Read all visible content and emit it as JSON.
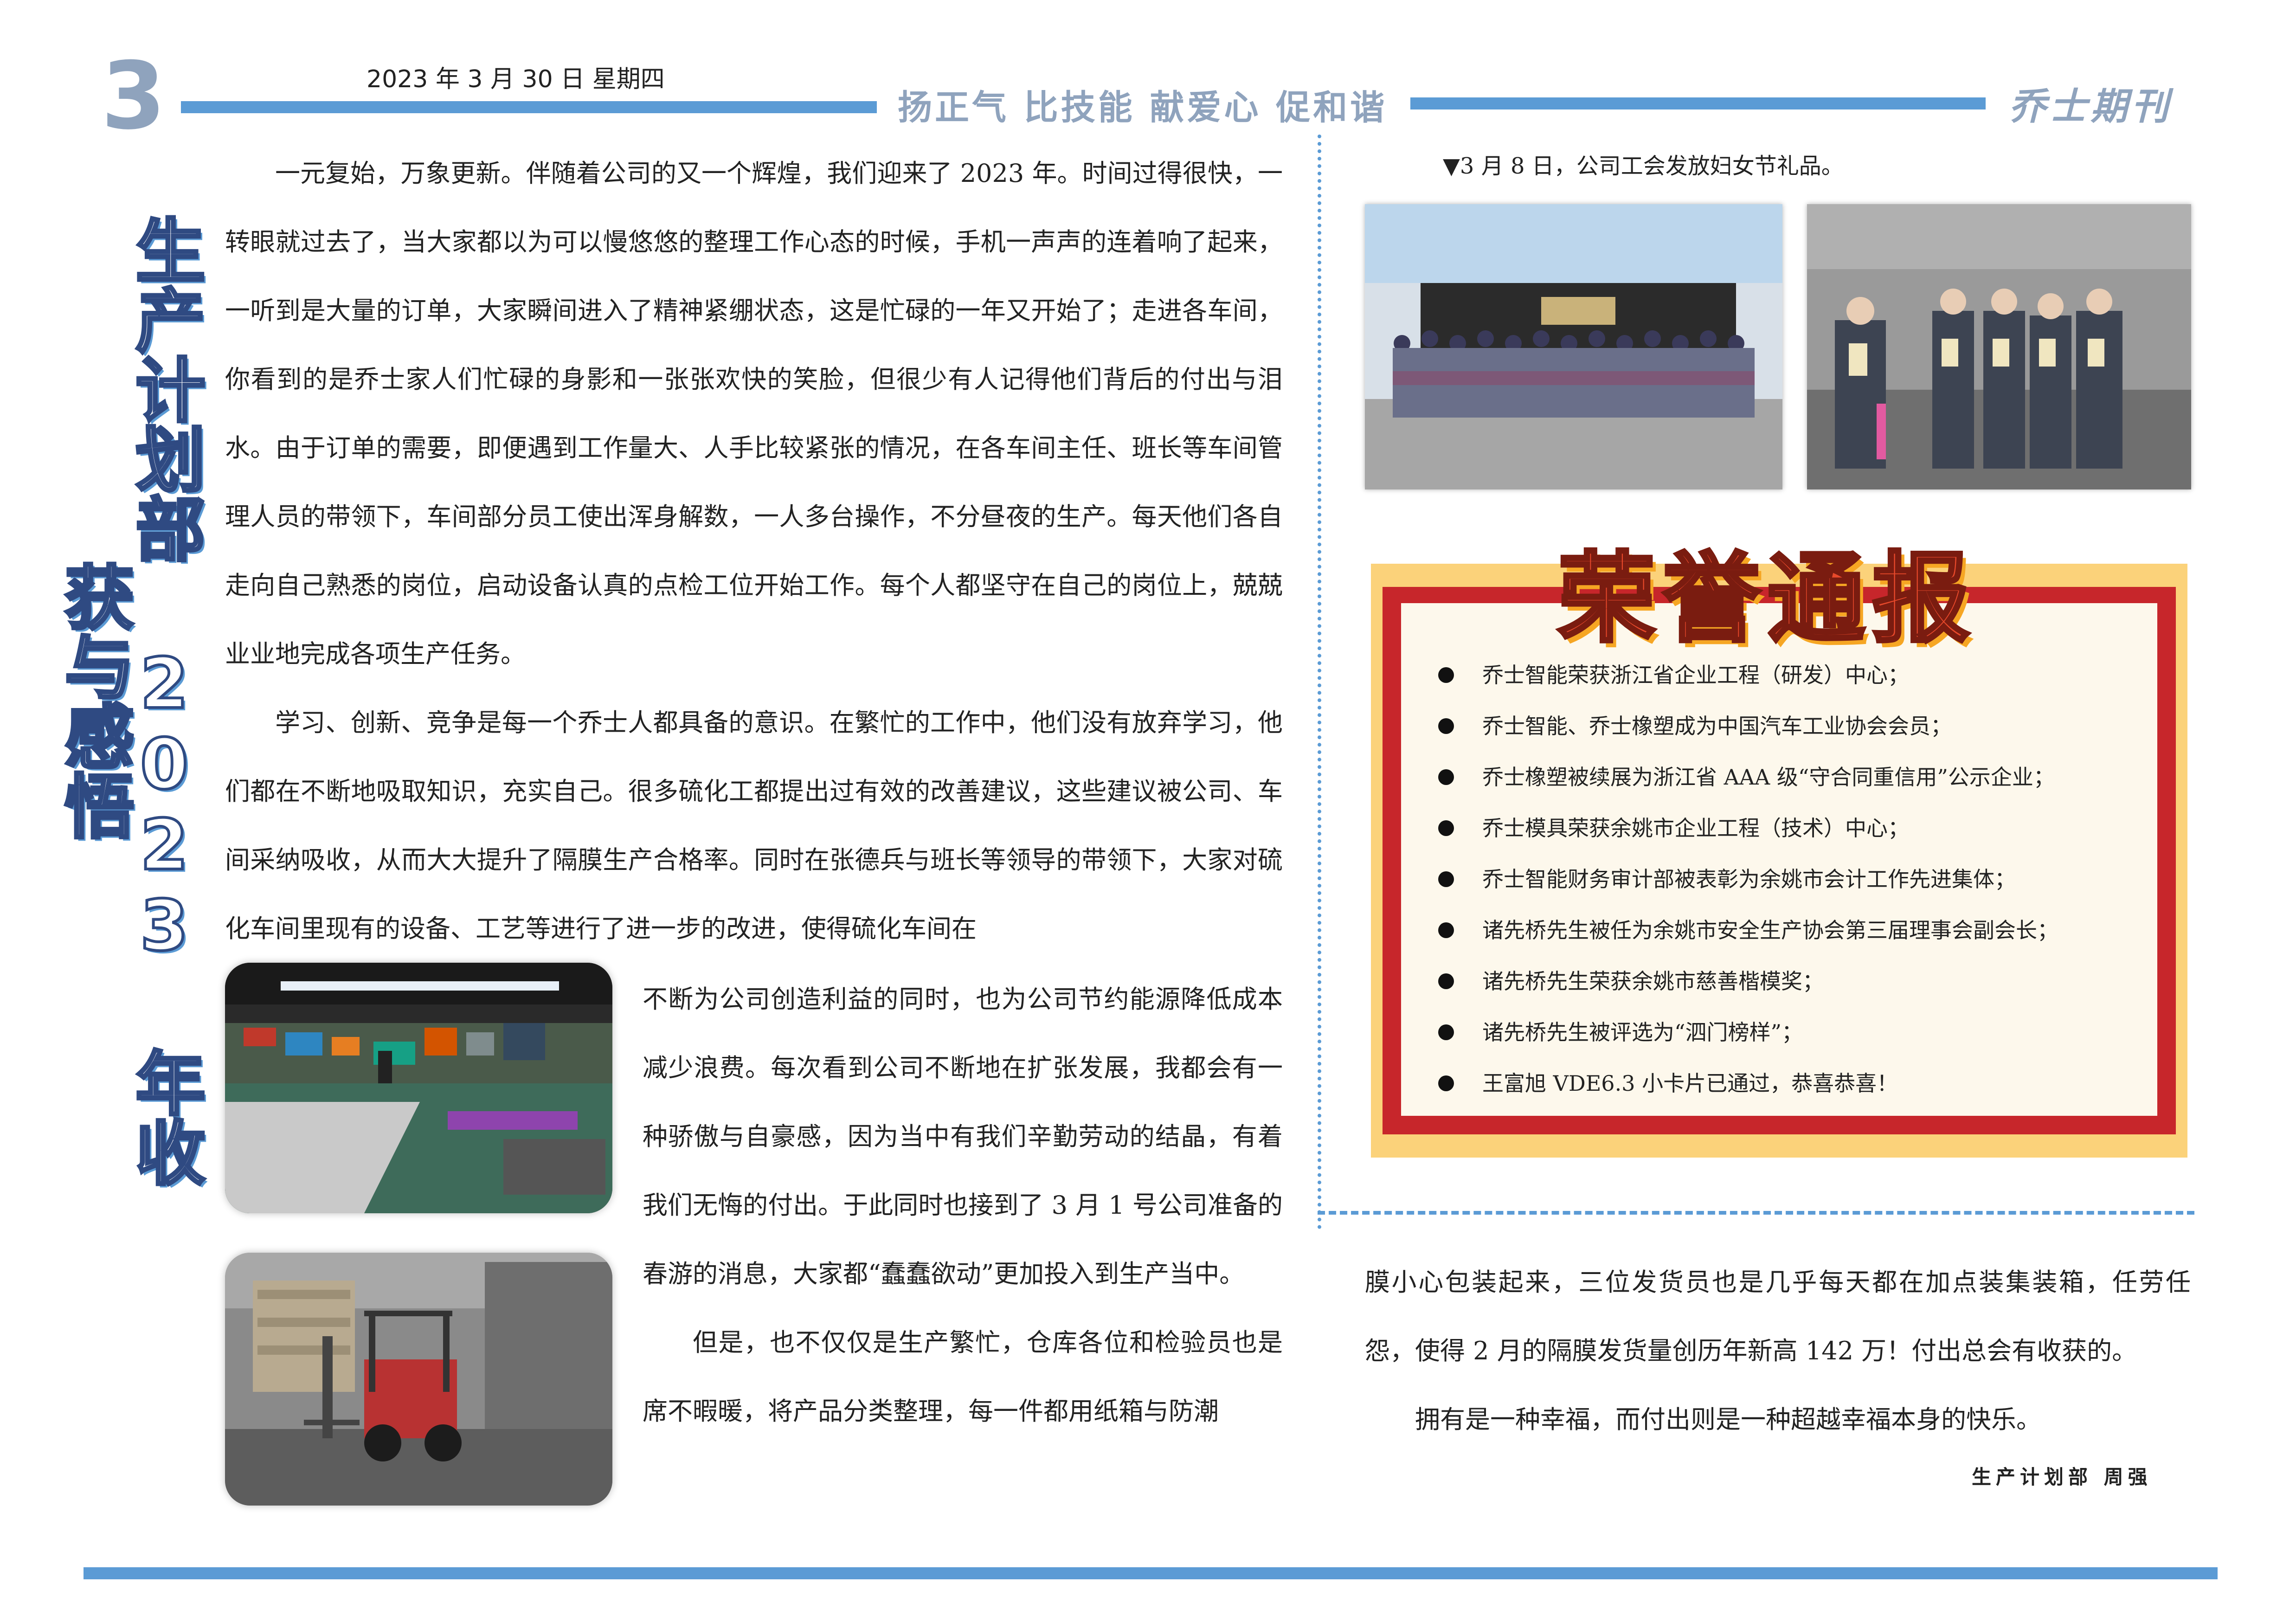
{
  "header": {
    "page_number": "3",
    "date": "2023 年 3 月 30 日    星期四",
    "slogan": "扬正气  比技能  献爱心  促和谐",
    "brand": "乔士期刊"
  },
  "article": {
    "title": "生产计划部 2023 年收获与感悟",
    "paragraph_1": "一元复始，万象更新。伴随着公司的又一个辉煌，我们迎来了 2023 年。时间过得很快，一转眼就过去了，当大家都以为可以慢悠悠的整理工作心态的时候，手机一声声的连着响了起来，一听到是大量的订单，大家瞬间进入了精神紧绷状态，这是忙碌的一年又开始了；走进各车间，你看到的是乔士家人们忙碌的身影和一张张欢快的笑脸，但很少有人记得他们背后的付出与泪水。由于订单的需要，即便遇到工作量大、人手比较紧张的情况，在各车间主任、班长等车间管理人员的带领下，车间部分员工使出浑身解数，一人多台操作，不分昼夜的生产。每天他们各自走向自己熟悉的岗位，启动设备认真的点检工位开始工作。每个人都坚守在自己的岗位上，兢兢业业地完成各项生产任务。",
    "paragraph_2": "学习、创新、竞争是每一个乔士人都具备的意识。在繁忙的工作中，他们没有放弃学习，他们都在不断地吸取知识，充实自己。很多硫化工都提出过有效的改善建议，这些建议被公司、车间采纳吸收，从而大大提升了隔膜生产合格率。同时在张德兵与班长等领导的带领下，大家对硫化车间里现有的设备、工艺等进行了进一步的改进，使得硫化车间在",
    "paragraph_2_cont": "不断为公司创造利益的同时，也为公司节约能源降低成本减少浪费。每次看到公司不断地在扩张发展，我都会有一种骄傲与自豪感，因为当中有我们辛勤劳动的结晶，有着我们无悔的付出。于此同时也接到了 3 月 1 号公司准备的春游的消息，大家都“蠢蠢欲动”更加投入到生产当中。",
    "paragraph_3": "但是，也不仅仅是生产繁忙，仓库各位和检验员也是席不暇暖，将产品分类整理，每一件都用纸箱与防潮",
    "paragraph_3_cont": "膜小心包装起来，三位发货员也是几乎每天都在加点装集装箱，任劳任怨，使得 2 月的隔膜发货量创历年新高 142 万！付出总会有收获的。",
    "paragraph_4": "拥有是一种幸福，而付出则是一种超越幸福本身的快乐。",
    "signature": "生产计划部    周强"
  },
  "photos": {
    "caption": "▼3 月 8 日，公司工会发放妇女节礼品。"
  },
  "honor": {
    "title": "荣誉通报",
    "items": [
      "乔士智能荣获浙江省企业工程（研发）中心；",
      "乔士智能、乔士橡塑成为中国汽车工业协会会员；",
      "乔士橡塑被续展为浙江省 AAA 级“守合同重信用”公示企业；",
      "乔士模具荣获余姚市企业工程（技术）中心；",
      "乔士智能财务审计部被表彰为余姚市会计工作先进集体；",
      "诸先桥先生被任为余姚市安全生产协会第三届理事会副会长；",
      "诸先桥先生荣获余姚市慈善楷模奖；",
      "诸先桥先生被评选为“泗门榜样”；",
      "王富旭 VDE6.3 小卡片已通过，恭喜恭喜！"
    ]
  },
  "colors": {
    "accent_blue": "#5b9bd5",
    "header_gray_blue": "#8fa3bd",
    "honor_red": "#c7262b",
    "honor_gold": "#fbd27a"
  }
}
